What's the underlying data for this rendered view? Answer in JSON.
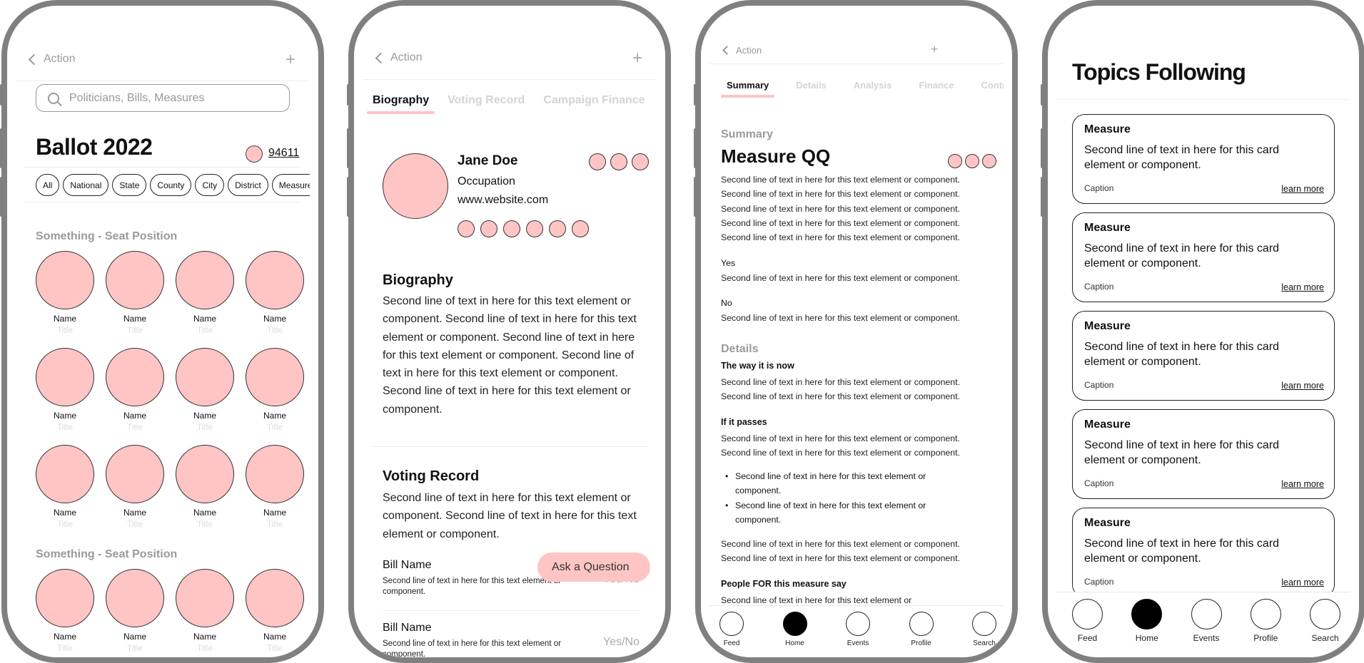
{
  "colors": {
    "accent_pink": "#ffc5c5",
    "frame_gray": "#808080",
    "muted_text": "#9a9a9a"
  },
  "screen1": {
    "nav": {
      "back_label": "Action",
      "plus_icon": "+"
    },
    "search": {
      "placeholder": "Politicians, Bills, Measures",
      "icon": "search-icon"
    },
    "title": "Ballot 2022",
    "zip": "94611",
    "filters": [
      "All",
      "National",
      "State",
      "County",
      "City",
      "District",
      "Measures"
    ],
    "sections": [
      {
        "heading": "Something - Seat Position",
        "people": [
          {
            "name": "Name",
            "title": "Title"
          },
          {
            "name": "Name",
            "title": "Title"
          },
          {
            "name": "Name",
            "title": "Title"
          },
          {
            "name": "Name",
            "title": "Title"
          },
          {
            "name": "Name",
            "title": "Title"
          },
          {
            "name": "Name",
            "title": "Title"
          },
          {
            "name": "Name",
            "title": "Title"
          },
          {
            "name": "Name",
            "title": "Title"
          },
          {
            "name": "Name",
            "title": "Title"
          },
          {
            "name": "Name",
            "title": "Title"
          },
          {
            "name": "Name",
            "title": "Title"
          },
          {
            "name": "Name",
            "title": "Title"
          }
        ]
      },
      {
        "heading": "Something - Seat Position",
        "people": [
          {
            "name": "Name",
            "title": "Title"
          },
          {
            "name": "Name",
            "title": "Title"
          },
          {
            "name": "Name",
            "title": "Title"
          },
          {
            "name": "Name",
            "title": "Title"
          }
        ]
      }
    ]
  },
  "screen2": {
    "nav": {
      "back_label": "Action",
      "plus_icon": "+"
    },
    "tabs": [
      {
        "label": "Biography",
        "active": true
      },
      {
        "label": "Voting Record",
        "active": false
      },
      {
        "label": "Campaign Finance",
        "active": false
      }
    ],
    "profile": {
      "name": "Jane Doe",
      "occupation": "Occupation",
      "website": "www.website.com"
    },
    "biography": {
      "heading": "Biography",
      "text": "Second line of text in here for this text element or component. Second line of text in here for this text element or component. Second line of text in here for this text element or component. Second line of text in here for this text element or component. Second line of text in here for this text element or component."
    },
    "voting_record": {
      "heading": "Voting Record",
      "text": "Second line of text in here for this text element or component. Second line of text in here for this text element or component.",
      "bills": [
        {
          "name": "Bill Name",
          "desc": "Second line of text in here for this text element or component.",
          "vote": "Yes/No"
        },
        {
          "name": "Bill Name",
          "desc": "Second line of text in here for this text element or component.",
          "vote": "Yes/No"
        }
      ]
    },
    "ask_button": "Ask a Question"
  },
  "screen3": {
    "nav": {
      "back_label": "Action",
      "plus_icon": "+"
    },
    "tabs": [
      {
        "label": "Summary",
        "active": true
      },
      {
        "label": "Details",
        "active": false
      },
      {
        "label": "Analysis",
        "active": false
      },
      {
        "label": "Finance",
        "active": false
      },
      {
        "label": "Contr",
        "active": false
      }
    ],
    "section_label": "Summary",
    "title": "Measure QQ",
    "summary_lines": [
      "Second line of text in here for this text element or component.",
      "Second line of text in here for this text element or component.",
      "Second line of text in here for this text element or component.",
      "Second line of text in here for this text element or component.",
      "Second line of text in here for this text element or component."
    ],
    "yes": {
      "label": "Yes",
      "text": "Second line of text in here for this text element or component."
    },
    "no": {
      "label": "No",
      "text": "Second line of text in here for this text element or component."
    },
    "details_label": "Details",
    "way_now": {
      "heading": "The way it is now",
      "lines": [
        "Second line of text in here for this text element or component.",
        "Second line of text in here for this text element or component."
      ]
    },
    "if_passes": {
      "heading": "If it passes",
      "lines": [
        "Second line of text in here for this text element or component.",
        "Second line of text in here for this text element or component."
      ]
    },
    "bullets": [
      "Second line of text in here for this text element or component.",
      "Second line of text in here for this text element or component."
    ],
    "after_bullets": [
      "Second line of text in here for this text element or component.",
      "Second line of text in here for this text element or component."
    ],
    "people_for": {
      "heading": "People FOR this measure say",
      "text": "Second line of text in here for this text element or"
    },
    "tabbar": [
      {
        "label": "Feed",
        "active": false
      },
      {
        "label": "Home",
        "active": true
      },
      {
        "label": "Events",
        "active": false
      },
      {
        "label": "Profile",
        "active": false
      },
      {
        "label": "Search",
        "active": false
      }
    ]
  },
  "screen4": {
    "title": "Topics Following",
    "cards": [
      {
        "heading": "Measure",
        "body": "Second line of text in here for this card element or component.",
        "caption": "Caption",
        "link": "learn more"
      },
      {
        "heading": "Measure",
        "body": "Second line of text in here for this card element or component.",
        "caption": "Caption",
        "link": "learn more"
      },
      {
        "heading": "Measure",
        "body": "Second line of text in here for this card element or component.",
        "caption": "Caption",
        "link": "learn more"
      },
      {
        "heading": "Measure",
        "body": "Second line of text in here for this card element or component.",
        "caption": "Caption",
        "link": "learn more"
      },
      {
        "heading": "Measure",
        "body": "Second line of text in here for this card element or component.",
        "caption": "Caption",
        "link": "learn more"
      }
    ],
    "tabbar": [
      {
        "label": "Feed",
        "active": false
      },
      {
        "label": "Home",
        "active": true
      },
      {
        "label": "Events",
        "active": false
      },
      {
        "label": "Profile",
        "active": false
      },
      {
        "label": "Search",
        "active": false
      }
    ]
  }
}
